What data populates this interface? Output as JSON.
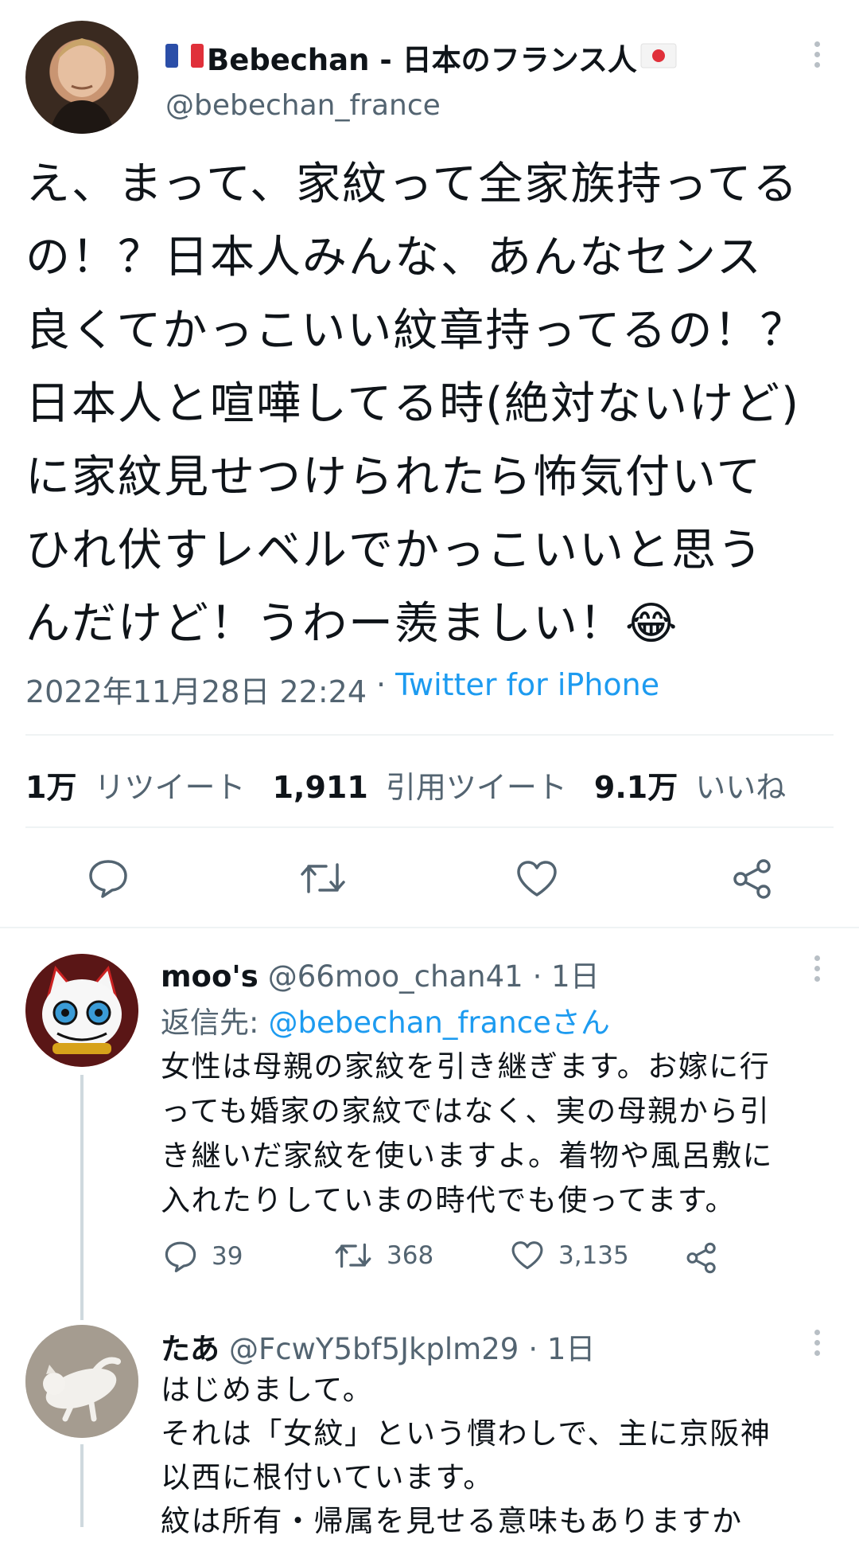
{
  "colors": {
    "accent": "#1d9bf0",
    "muted": "#536471",
    "text": "#0f1419",
    "divider": "#eff3f4",
    "thread_line": "#cfd9de"
  },
  "main_tweet": {
    "display_name": "Bebechan - 日本のフランス人",
    "handle": "@bebechan_france",
    "text_lines": [
      "え、まって、家紋って全家族持ってる",
      "の！？日本人みんな、あんなセンス",
      "良くてかっこいい紋章持ってるの！？",
      "日本人と喧嘩してる時(絶対ないけど)",
      "に家紋見せつけられたら怖気付いて",
      "ひれ伏すレベルでかっこいいと思う",
      "んだけど！うわー羨ましい！😂"
    ],
    "timestamp": "2022年11月28日 22:24",
    "separator": "·",
    "source": "Twitter for iPhone",
    "stats": {
      "retweets_count": "1万",
      "retweets_label": "リツイート",
      "quotes_count": "1,911",
      "quotes_label": "引用ツイート",
      "likes_count": "9.1万",
      "likes_label": "いいね"
    },
    "icons": [
      "reply-icon",
      "retweet-icon",
      "like-icon",
      "share-icon",
      "more-icon"
    ]
  },
  "replies": [
    {
      "display_name": "moo's",
      "handle": "@66moo_chan41",
      "time": "· 1日",
      "reply_to_label": "返信先:",
      "reply_to_handle": "@bebechan_franceさん",
      "text_lines": [
        "女性は母親の家紋を引き継ぎます。お嫁に行",
        "っても婚家の家紋ではなく、実の母親から引",
        "き継いだ家紋を使いますよ。着物や風呂敷に",
        "入れたりしていまの時代でも使ってます。"
      ],
      "reply_count": "39",
      "retweet_count": "368",
      "like_count": "3,135"
    },
    {
      "display_name": "たあ",
      "handle": "@FcwY5bf5Jkplm29",
      "time": "· 1日",
      "text_lines": [
        "はじめまして。",
        "それは「女紋」という慣わしで、主に京阪神",
        "以西に根付いています。",
        "紋は所有・帰属を見せる意味もありますか"
      ]
    }
  ]
}
